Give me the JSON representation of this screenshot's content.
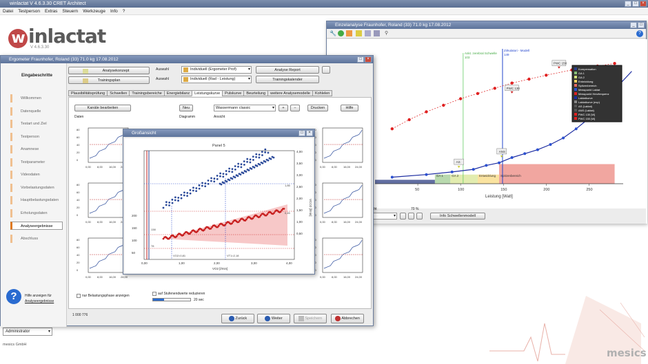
{
  "app": {
    "title": "winlactat V 4.6.3.30 CRET Architect",
    "logo_text": "inlactat",
    "logo_version": "V 4.6.3.30",
    "company": "mesics GmbH",
    "user_dropdown": "Administrator",
    "menu": [
      "Datei",
      "Testperson",
      "Extras",
      "Steuern",
      "Werkzeuge",
      "Info",
      "?"
    ]
  },
  "main_window": {
    "title": "Ergometer Fraunhofer, Roland (33) 71.0 kg 17.08.2012",
    "sidebar_title": "Eingabeschritte",
    "sidebar_items": [
      "Willkommen",
      "Datenquelle",
      "Testart und Ziel",
      "Testperson",
      "Anamnese",
      "Testparameter",
      "Videodaten",
      "Vorbelastungsdaten",
      "Hauptbelastungsdaten",
      "Erholungsdaten",
      "Analyseergebnisse",
      "Abschluss"
    ],
    "active_item": "Analyseergebnisse",
    "help_text": "Hilfe anzeigen für",
    "help_link": "Analyseergebnisse",
    "top_buttons": {
      "analysis_concept": "Analysekonzept",
      "training_plan": "Trainingsplan",
      "analysis_report": "Analyse Report",
      "training_calendar": "Trainingskalender"
    },
    "auswahl_label": "Auswahl",
    "select1": "Individuell (Ergometer Prof)",
    "select2": "Individuell (Rad - Leistung)",
    "tabs": [
      "Plausibilitätsprüfung",
      "Schwellen",
      "Trainingsbereiche",
      "Energiebilanz",
      "Leistungskurve",
      "Pulskurve",
      "Beurteilung",
      "weitere Analysemodelle",
      "Kohlelen"
    ],
    "controls": {
      "edit_data": "Kanäle bearbeiten",
      "daten_label": "Daten",
      "new_btn": "Neu",
      "diagram_label": "Diagramm",
      "view_select": "Wassermann classic",
      "view_label": "Ansicht",
      "print_btn": "Drucken",
      "help_btn": "Hilfe"
    },
    "checkbox1": "nur Belastungsphase anzeigen",
    "checkbox2": "auf Stufenendwerte reduzieren",
    "progress_label": "20 sec",
    "status_id": "1 000 776",
    "nav_buttons": {
      "back": "Zurück",
      "next": "Weiter",
      "save": "Speichern",
      "cancel": "Abbrechen"
    },
    "mini_charts": {
      "ylabels": [
        "VE [l/min]",
        "VCO2 [l/min]",
        "VE [l/min]",
        "CO2 [%]"
      ],
      "ticks_left": [
        "80",
        "60",
        "40",
        "20",
        "0"
      ],
      "ticks_right": [
        "5,00",
        "4,00",
        "3,00",
        "2,00",
        "1,00"
      ],
      "xticks": [
        "0,00",
        "8,00",
        "16,00",
        "24,00"
      ],
      "panel_prefix": "Pan"
    }
  },
  "zoom_window": {
    "title": "Großansicht",
    "panel_title": "Panel 5",
    "xlabel": "VO2 [l/min]",
    "ylabel_left": "HF [1/min]",
    "ylabel_right": "VCO2 [l/min]",
    "xticks": [
      "0,00",
      "2,00",
      "4,00"
    ],
    "xticks_minor": [
      "1,00",
      "3,00"
    ],
    "yticks_left": [
      "200",
      "150",
      "100",
      "50"
    ],
    "yticks_right": [
      "4,00",
      "3,50",
      "3,00",
      "2,50",
      "2,00",
      "1,50",
      "1,00",
      "0,50"
    ],
    "annotations": [
      "VO2=0,81",
      "VT1=2,18",
      "138",
      "78",
      "0,45",
      "1,85"
    ]
  },
  "analysis_window": {
    "title": "Einzelanalyse Fraunhofer, Roland (33) 71.0 kg 17.08.2012",
    "xlabel": "Leistung [Watt]",
    "xticks": [
      "50",
      "100",
      "150",
      "200",
      "250"
    ],
    "markers": {
      "ankt": "Ankt. zerebral Schwelle",
      "ankt_val": "103",
      "zirk": "Zirkulatori - Modell",
      "zirk_val": "149",
      "pwc130": "PWC 130",
      "pwc150": "PWC 150",
      "as": "AS",
      "ans": "ANS"
    },
    "zones": [
      {
        "label": "",
        "color": "#3a4a8a"
      },
      {
        "label": "GA 1",
        "color": "#88c078"
      },
      {
        "label": "GA 2",
        "color": "#cfe07a"
      },
      {
        "label": "Entwicklung",
        "color": "#f6d060"
      },
      {
        "label": "Spitzenbereich",
        "color": "#e86a60"
      }
    ],
    "legend": [
      "Kompensation",
      "GA 1",
      "GA 2",
      "Entwicklung",
      "Spitzenbereich",
      "Messpunkt Laktat",
      "Messpunkt Herzfrequenz",
      "Laktatkurve",
      "Laktatkurve (exp)",
      "AS (Laktat)",
      "ANS (Laktat)",
      "PWC 130 [W]",
      "PWC 150 [W]"
    ],
    "legend_colors": [
      "#2b3f8a",
      "#88c078",
      "#cfe07a",
      "#f6d060",
      "#e86a60",
      "#2b50d0",
      "#e02020",
      "#1a2aa0",
      "#888",
      "#555",
      "#555",
      "#e02020",
      "#e02020"
    ],
    "bottom_label": "nicht",
    "zoom_pct": "70 %",
    "info_btn": "Info Schwellenmodell",
    "lactate_curve": {
      "x": [
        20,
        60,
        90,
        115,
        130,
        145,
        160,
        175,
        190,
        205,
        220,
        235,
        250,
        265,
        280,
        300
      ],
      "y": [
        0.25,
        0.35,
        0.45,
        0.55,
        0.7,
        0.8,
        1.0,
        1.15,
        1.3,
        1.5,
        1.75,
        2.1,
        2.5,
        3.0,
        3.6,
        4.3
      ]
    },
    "hr_curve": {
      "x": [
        20,
        40,
        60,
        80,
        100,
        120,
        140,
        160,
        180,
        200,
        230,
        260,
        280
      ],
      "y": [
        2.1,
        2.45,
        2.75,
        3.0,
        3.25,
        3.45,
        3.65,
        3.85,
        4.0,
        4.15,
        4.35,
        4.5,
        4.6
      ]
    }
  }
}
